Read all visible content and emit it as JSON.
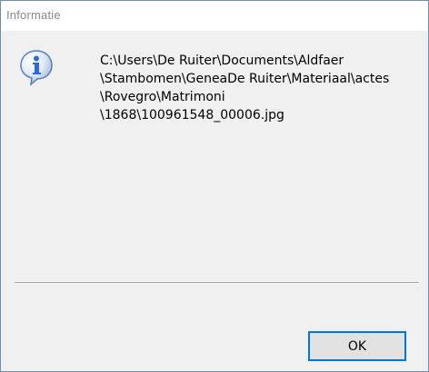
{
  "window": {
    "title": "Informatie"
  },
  "message": {
    "lines": [
      "C:\\Users\\De Ruiter\\Documents\\Aldfaer",
      "\\Stambomen\\GeneaDe Ruiter\\Materiaal\\actes",
      "\\Rovegro\\Matrimoni",
      "\\1868\\100961548_00006.jpg"
    ]
  },
  "icon": {
    "name": "info-icon",
    "glyph": "i",
    "color": "#2d6bd0"
  },
  "buttons": {
    "ok_label": "OK"
  },
  "colors": {
    "accent": "#0078d7",
    "dialog_bg": "#f0f0f0",
    "titlebar_bg": "#ffffff",
    "title_text": "#8a8a8a"
  }
}
